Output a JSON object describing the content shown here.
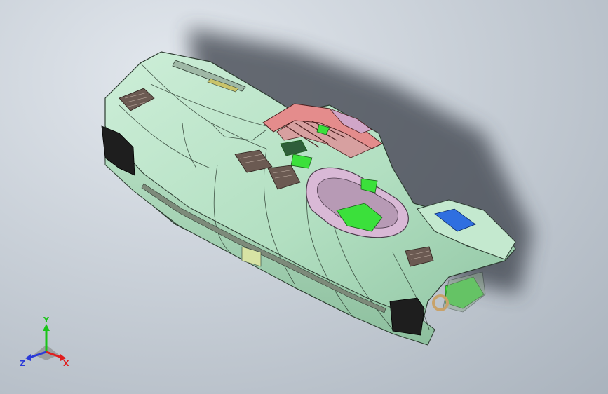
{
  "viewport": {
    "background_top": "#e3e8ee",
    "background_bottom": "#aab3bd"
  },
  "model": {
    "body_color": "#b7e3c6",
    "body_shade": "#93c9a6",
    "edge_color": "#2b3a2f",
    "frame_color": "#e48c8c",
    "inner_color": "#d9b9d6",
    "part_green": "#3be03b",
    "vent_color": "#6b5a52",
    "speaker_color": "#1e1e1e",
    "badge_color": "#2f6fe0",
    "bracket_color": "#c8a26a"
  },
  "triad": {
    "y_label": "Y",
    "x_label": "X",
    "z_label": "Z",
    "y_color": "#19c419",
    "x_color": "#e01e1e",
    "z_color": "#2a3ad8"
  }
}
